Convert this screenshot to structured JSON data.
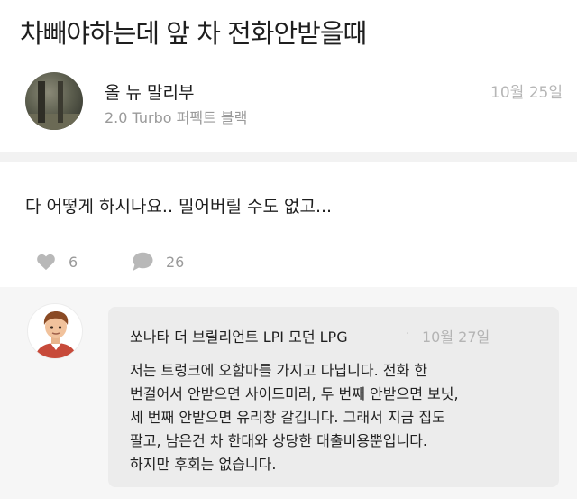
{
  "post": {
    "title": "차빼야하는데 앞 차 전화안받을때",
    "author": {
      "name": "올 뉴 말리부",
      "subtitle": "2.0 Turbo 퍼펙트 블랙"
    },
    "date": "10월 25일",
    "body": "다 어떻게 하시나요.. 밀어버릴 수도 없고...",
    "likes": "6",
    "comments_count": "26"
  },
  "comment": {
    "author": "쏘나타 더 브릴리언트 LPI 모던 LPG",
    "separator": "·",
    "date": "10월 27일",
    "lines": [
      "저는 트렁크에 오함마를 가지고 다닙니다. 전화 한",
      "번걸어서 안받으면 사이드미러, 두 번째 안받으면 보닛,",
      "세 번째 안받으면 유리창 갈깁니다. 그래서 지금 집도",
      "팔고, 남은건 차 한대와 상당한 대출비용뿐입니다.",
      "하지만 후회는 없습니다."
    ]
  },
  "icons": {
    "like": "heart-icon",
    "comment": "speech-bubble-icon"
  },
  "colors": {
    "muted_text": "#9a9a9a",
    "icon_gray": "#b8b8b8",
    "comment_bg": "#ececec"
  }
}
